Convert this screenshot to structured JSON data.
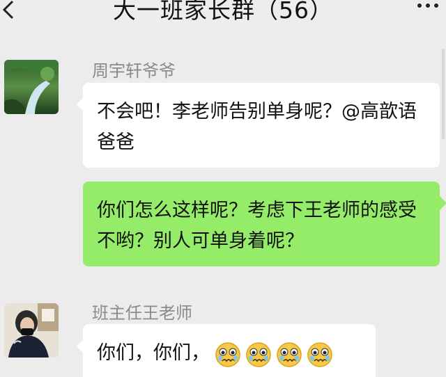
{
  "header": {
    "title": "大一班家长群（56）",
    "back_icon": "chevron-left-icon",
    "more_icon": "more-dots-icon"
  },
  "messages": [
    {
      "sender": "周宇轩爷爷",
      "side": "left",
      "avatar": "green-landscape-avatar",
      "text": "不会吧！李老师告别单身呢？@高歆语爸爸"
    },
    {
      "sender": "",
      "side": "right",
      "text": "你们怎么这样呢？考虑下王老师的感受不哟？别人可单身着呢？"
    },
    {
      "sender": "班主任王老师",
      "side": "left",
      "avatar": "person-photo-avatar",
      "text": "你们，你们，",
      "emojis": [
        "crying-face-icon",
        "crying-face-icon",
        "crying-face-icon",
        "crying-face-icon"
      ]
    }
  ],
  "colors": {
    "background": "#ececec",
    "bubble_self": "#95ec69",
    "bubble_other": "#ffffff",
    "name_text": "#8a8a8a"
  }
}
